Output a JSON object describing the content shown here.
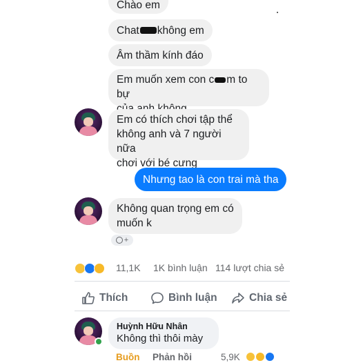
{
  "messages": {
    "m1": "Chào em",
    "m2_before": "Chat",
    "m2_after": "không em",
    "m3": "Âm thầm kính đáo",
    "m4_line1": "Em muốn xem con c",
    "m4_line1_end": "m to bự",
    "m4_line2": "của anh không",
    "m5_line1": "Em có thích chơi tập thể",
    "m5_line2": "không anh và 7 người nữa",
    "m5_line3": "chơi với bé cưng",
    "m6_out": "Nhưng tao là con trai mà tha",
    "m7_line1": "Không quan trọng em có",
    "m7_line2": "muốn k",
    "react_add": "+"
  },
  "stats": {
    "reactions": "11,1K",
    "comments": "1K bình luận",
    "shares": "114 lượt chia sẻ"
  },
  "actions": {
    "like": "Thích",
    "comment": "Bình luận",
    "share": "Chia sẻ"
  },
  "comment": {
    "author": "Huỳnh Hữu Nhân",
    "text": "Không thì thôi mày",
    "reaction_label": "Buồn",
    "reply": "Phản hồi",
    "count": "5,9K"
  },
  "colors": {
    "outgoing": "#0a7cff",
    "incoming": "#f0f0f0",
    "sad_reaction": "#e69c1e",
    "like_blue": "#1877f2"
  }
}
